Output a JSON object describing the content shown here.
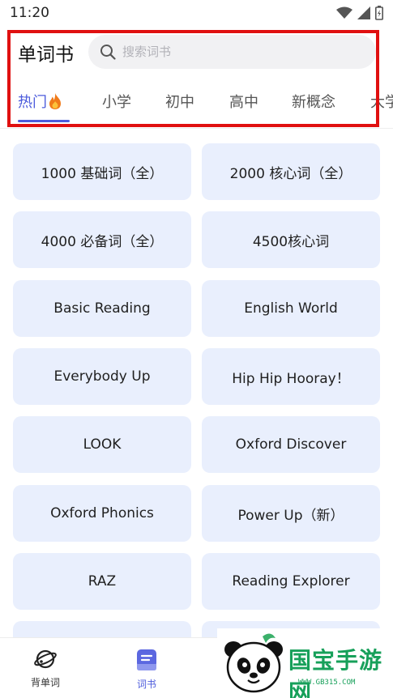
{
  "status_bar": {
    "time": "11:20",
    "icons": [
      "wifi-icon",
      "signal-icon",
      "battery-icon"
    ]
  },
  "header": {
    "title": "单词书",
    "search": {
      "placeholder": "搜索词书",
      "icon": "search-icon"
    }
  },
  "tabs": [
    {
      "label": "热门",
      "active": true,
      "icon": "fire-icon"
    },
    {
      "label": "小学",
      "active": false
    },
    {
      "label": "初中",
      "active": false
    },
    {
      "label": "高中",
      "active": false
    },
    {
      "label": "新概念",
      "active": false
    },
    {
      "label": "大学",
      "active": false
    }
  ],
  "books": [
    "1000 基础词（全）",
    "2000 核心词（全）",
    "4000 必备词（全）",
    "4500核心词",
    "Basic Reading",
    "English World",
    "Everybody Up",
    "Hip Hip Hooray！",
    "LOOK",
    "Oxford Discover",
    "Oxford Phonics",
    "Power Up（新）",
    "RAZ",
    "Reading Explorer",
    "",
    ""
  ],
  "bottom_nav": [
    {
      "label": "背单词",
      "icon": "planet-icon",
      "active": false
    },
    {
      "label": "词书",
      "icon": "book-icon",
      "active": true
    }
  ],
  "watermark": {
    "text": "国宝手游网",
    "url": "WWW.GB315.COM"
  },
  "colors": {
    "accent": "#4c5bdc",
    "card_bg": "#e9effd",
    "highlight": "#e01010",
    "watermark": "#17a05a"
  }
}
